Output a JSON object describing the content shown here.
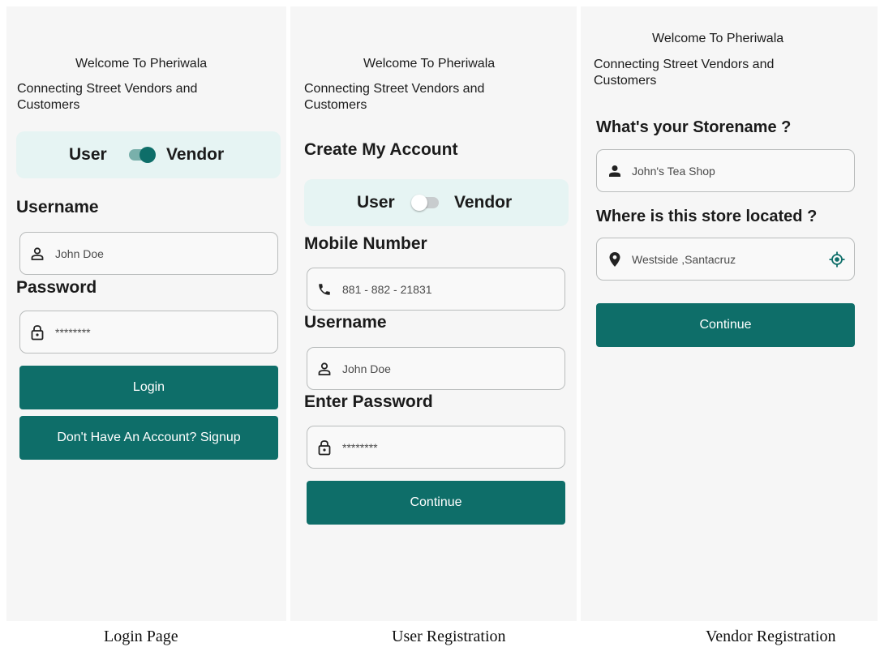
{
  "login": {
    "welcome": "Welcome To Pheriwala",
    "tagline": "Connecting Street Vendors and Customers",
    "toggle": {
      "left": "User",
      "right": "Vendor",
      "state": "vendor"
    },
    "username_label": "Username",
    "username_value": "John Doe",
    "password_label": "Password",
    "password_value": "********",
    "login_button": "Login",
    "signup_button": "Don't Have An Account? Signup"
  },
  "user_registration": {
    "welcome": "Welcome To Pheriwala",
    "tagline": "Connecting Street Vendors and Customers",
    "title": "Create My Account",
    "toggle": {
      "left": "User",
      "right": "Vendor",
      "state": "user"
    },
    "mobile_label": "Mobile Number",
    "mobile_value": "881 - 882 - 21831",
    "username_label": "Username",
    "username_value": "John Doe",
    "password_label": "Enter Password",
    "password_value": "********",
    "continue_button": "Continue"
  },
  "vendor_registration": {
    "welcome": "Welcome To Pheriwala",
    "tagline": "Connecting Street Vendors and Customers",
    "storename_label": "What's your Storename ?",
    "storename_value": "John's Tea Shop",
    "location_label": "Where is this store located ?",
    "location_value": "Westside ,Santacruz",
    "continue_button": "Continue"
  },
  "captions": {
    "login": "Login Page",
    "user": "User Registration",
    "vendor": "Vendor Registration"
  },
  "colors": {
    "primary": "#0e6e69",
    "toggle_card": "#e6f4f3",
    "screen_bg": "#f6f6f6"
  },
  "icons": [
    "person-outline-icon",
    "lock-icon",
    "phone-icon",
    "person-icon",
    "location-pin-icon",
    "gps-target-icon"
  ]
}
